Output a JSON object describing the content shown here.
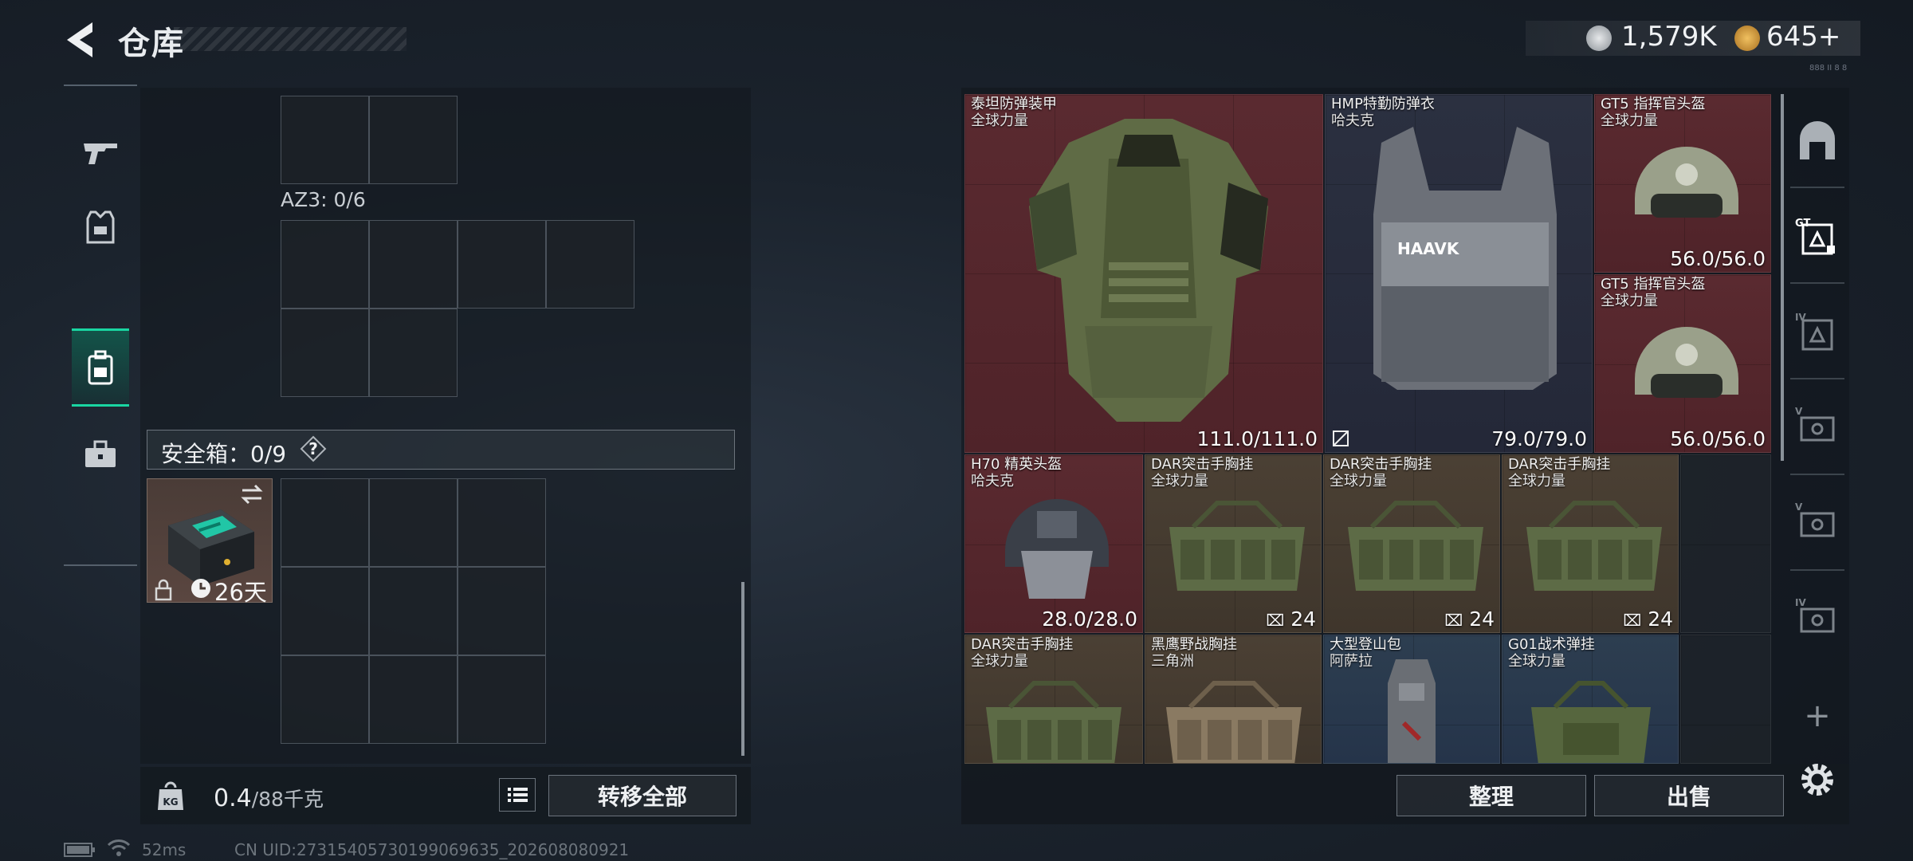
{
  "header": {
    "title": "仓库",
    "currency_1": "1,579K",
    "currency_2": "645+",
    "version": "888 II 8 8"
  },
  "left": {
    "az3_label": "AZ3: 0/6",
    "safebox_label": "安全箱：0/9",
    "help": "?",
    "safecase_days": "26天",
    "weight_current": "0.4",
    "weight_max": "/88千克",
    "weight_icon_text": "KG",
    "transfer_all": "转移全部"
  },
  "items": [
    {
      "name": "泰坦防弹装甲",
      "sub": "全球力量",
      "dur": "111.0/111.0"
    },
    {
      "name": "HMP特勤防弹衣",
      "sub": "哈夫克",
      "dur": "79.0/79.0",
      "logo": "HAAVK"
    },
    {
      "name": "GT5 指挥官头盔",
      "sub": "全球力量",
      "dur": "56.0/56.0"
    },
    {
      "name": "GT5 指挥官头盔",
      "sub": "全球力量",
      "dur": "56.0/56.0"
    },
    {
      "name": "H70 精英头盔",
      "sub": "哈夫克",
      "dur": "28.0/28.0"
    },
    {
      "name": "DAR突击手胸挂",
      "sub": "全球力量",
      "cap": "24"
    },
    {
      "name": "DAR突击手胸挂",
      "sub": "全球力量",
      "cap": "24"
    },
    {
      "name": "DAR突击手胸挂",
      "sub": "全球力量",
      "cap": "24"
    },
    {
      "name": "DAR突击手胸挂",
      "sub": "全球力量"
    },
    {
      "name": "黑鹰野战胸挂",
      "sub": "三角洲"
    },
    {
      "name": "大型登山包",
      "sub": "阿萨拉"
    },
    {
      "name": "G01战术弹挂",
      "sub": "全球力量"
    }
  ],
  "right_buttons": {
    "organize": "整理",
    "sell": "出售"
  },
  "sidebar": {
    "gt_label": "GT",
    "tiers": [
      "IV",
      "V",
      "V",
      "IV"
    ],
    "add": "+"
  },
  "status": {
    "ping": "52ms",
    "uid": "CN UID:2731540573019906963​5_202608080921"
  },
  "colors": {
    "accent": "#19d6a2",
    "red_item": "#5a2a30",
    "brown_item": "#4b4034",
    "blue_item": "#2d3e50"
  }
}
